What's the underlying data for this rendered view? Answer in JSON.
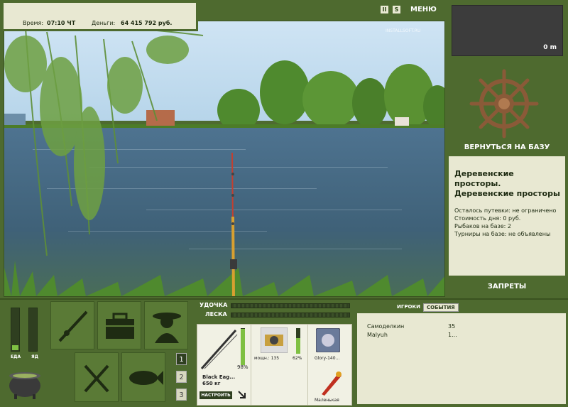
{
  "info": {
    "time_label": "Время:",
    "time_value": "07:10 ЧТ",
    "money_label": "Деньги:",
    "money_value": "64 415 792 руб."
  },
  "top_controls": {
    "pause": "II",
    "sound": "S",
    "menu": "МЕНЮ"
  },
  "watermark": "INSTALLSOFT.RU",
  "depth": "0 m",
  "return_button": "ВЕРНУТЬСЯ НА БАЗУ",
  "location": {
    "title": "Деревенские просторы. Деревенские просторы",
    "lines": [
      "Осталось путевки: не ограничено",
      "Стоимость дня: 0 руб.",
      "Рыбаков на базе: 2",
      "Турниры на базе: не объявлены"
    ]
  },
  "bans_button": "ЗАПРЕТЫ",
  "status": {
    "food_label": "ЕДА",
    "poison_label": "ЯД",
    "food_level": 0.12,
    "poison_level": 0.0
  },
  "tackle": {
    "rod_label": "УДОЧКА",
    "line_label": "ЛЕСКА",
    "rod_name": "Black Eag...",
    "rod_capacity": "650 кг",
    "rod_percent": "98%",
    "rod_level": 0.98,
    "setup_button": "НАСТРОИТЬ",
    "reel_power": "мощн.: 135",
    "reel_percent": "62%",
    "reel_level": 0.62,
    "line_name": "Glory-140...",
    "lure_name": "Маленькая"
  },
  "sets": [
    "1",
    "2",
    "3"
  ],
  "players": {
    "tab_players": "ИГРОКИ",
    "tab_events": "СОБЫТИЯ",
    "rows": [
      {
        "name": "Самоделкин",
        "value": "35"
      },
      {
        "name": "Malyuh",
        "value": "1..."
      }
    ]
  },
  "colors": {
    "panel_green": "#4e6a2f",
    "panel_cream": "#e8e8d2",
    "bar_fill": "#7fc043"
  }
}
